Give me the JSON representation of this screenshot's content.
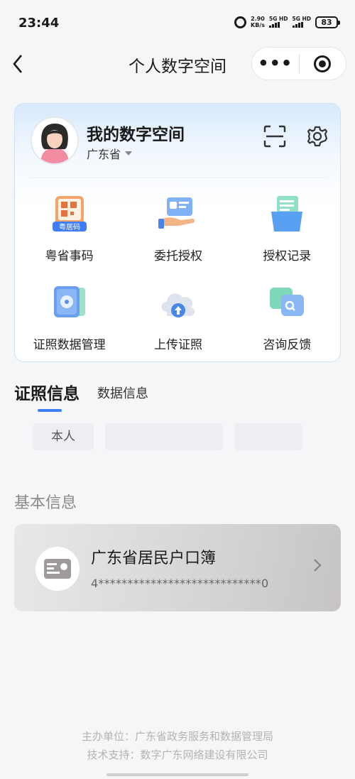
{
  "statusbar": {
    "time": "23:44",
    "speed_value": "2.90",
    "speed_unit": "KB/s",
    "sim1": "5G HD",
    "sim2": "5G HD",
    "battery": "83"
  },
  "navbar": {
    "title": "个人数字空间",
    "more_icon": "ellipsis-icon",
    "close_icon": "target-icon"
  },
  "profile": {
    "title": "我的数字空间",
    "region": "广东省"
  },
  "services": [
    {
      "label": "粤省事码",
      "icon": "qr-card-icon",
      "icon_text": "粤居码"
    },
    {
      "label": "委托授权",
      "icon": "hand-card-icon"
    },
    {
      "label": "授权记录",
      "icon": "file-folder-icon"
    },
    {
      "label": "证照数据管理",
      "icon": "safe-icon"
    },
    {
      "label": "上传证照",
      "icon": "cloud-upload-icon"
    },
    {
      "label": "咨询反馈",
      "icon": "chat-bubbles-icon"
    }
  ],
  "tabs": [
    {
      "label": "证照信息",
      "active": true
    },
    {
      "label": "数据信息",
      "active": false
    }
  ],
  "filters": [
    "本人",
    "",
    ""
  ],
  "basic_info": {
    "title": "基本信息",
    "cert_title": "广东省居民户口簿",
    "cert_id": "4****************************0"
  },
  "footer": {
    "line1": "主办单位：广东省政务服务和数据管理局",
    "line2": "技术支持：数字广东网络建设有限公司"
  },
  "colors": {
    "accent": "#3f7ef6",
    "card_border": "#cfe1f6"
  }
}
